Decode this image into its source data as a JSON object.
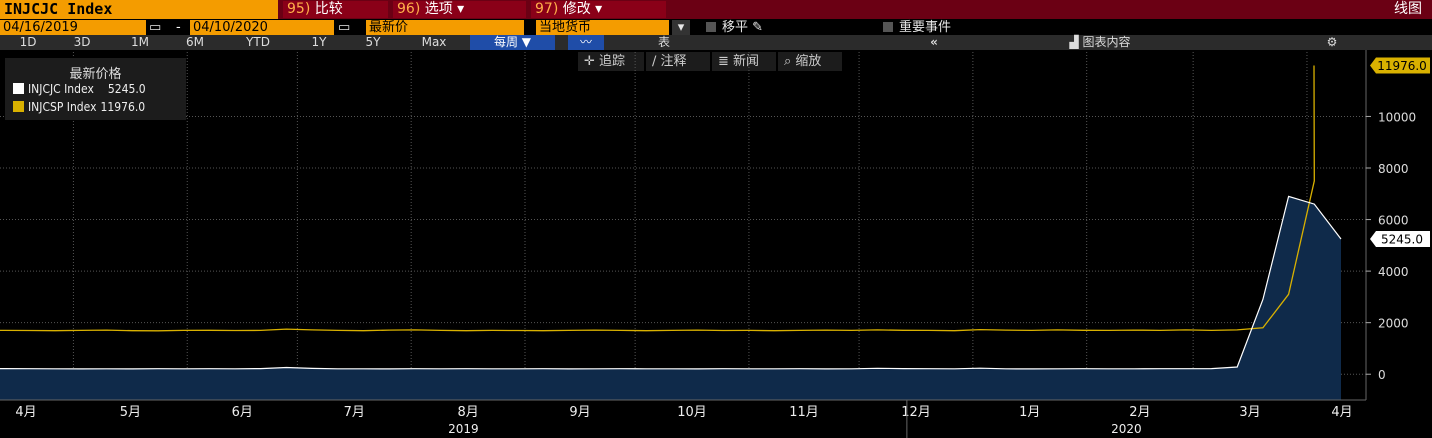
{
  "header": {
    "ticker": "INJCJC Index",
    "buttons": [
      {
        "num": "95)",
        "label": "比较"
      },
      {
        "num": "96)",
        "label": "选项 ▾"
      },
      {
        "num": "97)",
        "label": "修改 ▾"
      }
    ],
    "right_label": "线图"
  },
  "controls": {
    "start_date": "04/16/2019",
    "dash": "-",
    "end_date": "04/10/2020",
    "field": "最新价",
    "currency": "当地货币",
    "shift_label": "移平",
    "events_label": "重要事件"
  },
  "ranges": [
    "1D",
    "3D",
    "1M",
    "6M",
    "YTD",
    "1Y",
    "5Y",
    "Max"
  ],
  "frequency": "每周 ▼",
  "table_label": "表",
  "chart_content_label": "图表内容",
  "toolbar": [
    "追踪",
    "注释",
    "新闻",
    "缩放"
  ],
  "colors": {
    "series1": "#ffffff",
    "series2": "#d9b100",
    "area": "#0f2a4a"
  },
  "chart_data": {
    "type": "line",
    "title": "最新价格",
    "x_month_labels": [
      "4月",
      "5月",
      "6月",
      "7月",
      "8月",
      "9月",
      "10月",
      "11月",
      "12月",
      "1月",
      "2月",
      "3月",
      "4月"
    ],
    "years": [
      "2019",
      "2020"
    ],
    "ylim": [
      -1000,
      12500
    ],
    "yticks": [
      0,
      2000,
      4000,
      6000,
      8000,
      10000
    ],
    "series": [
      {
        "name": "INJCJC Index",
        "last": "5245.0",
        "color": "#ffffff",
        "x": [
          "2019-04-12",
          "2019-04-19",
          "2019-04-26",
          "2019-05-03",
          "2019-05-10",
          "2019-05-17",
          "2019-05-24",
          "2019-05-31",
          "2019-06-07",
          "2019-06-14",
          "2019-06-21",
          "2019-06-28",
          "2019-07-05",
          "2019-07-12",
          "2019-07-19",
          "2019-07-26",
          "2019-08-02",
          "2019-08-09",
          "2019-08-16",
          "2019-08-23",
          "2019-08-30",
          "2019-09-06",
          "2019-09-13",
          "2019-09-20",
          "2019-09-27",
          "2019-10-04",
          "2019-10-11",
          "2019-10-18",
          "2019-10-25",
          "2019-11-01",
          "2019-11-08",
          "2019-11-15",
          "2019-11-22",
          "2019-11-29",
          "2019-12-06",
          "2019-12-13",
          "2019-12-20",
          "2019-12-27",
          "2020-01-03",
          "2020-01-10",
          "2020-01-17",
          "2020-01-24",
          "2020-01-31",
          "2020-02-07",
          "2020-02-14",
          "2020-02-21",
          "2020-02-28",
          "2020-03-06",
          "2020-03-13",
          "2020-03-20",
          "2020-03-27",
          "2020-04-03"
        ],
        "values": [
          220,
          215,
          210,
          205,
          212,
          208,
          214,
          210,
          215,
          212,
          218,
          260,
          225,
          212,
          210,
          208,
          213,
          210,
          215,
          212,
          210,
          214,
          208,
          212,
          215,
          212,
          210,
          208,
          215,
          212,
          210,
          213,
          208,
          212,
          230,
          220,
          215,
          212,
          235,
          210,
          208,
          212,
          215,
          212,
          210,
          215,
          213,
          220,
          280,
          2900,
          6900,
          6600
        ]
      },
      {
        "name": "INJCSP Index",
        "last": "11976.0",
        "color": "#d9b100",
        "x": [
          "2019-04-12",
          "2019-04-19",
          "2019-04-26",
          "2019-05-03",
          "2019-05-10",
          "2019-05-17",
          "2019-05-24",
          "2019-05-31",
          "2019-06-07",
          "2019-06-14",
          "2019-06-21",
          "2019-06-28",
          "2019-07-05",
          "2019-07-12",
          "2019-07-19",
          "2019-07-26",
          "2019-08-02",
          "2019-08-09",
          "2019-08-16",
          "2019-08-23",
          "2019-08-30",
          "2019-09-06",
          "2019-09-13",
          "2019-09-20",
          "2019-09-27",
          "2019-10-04",
          "2019-10-11",
          "2019-10-18",
          "2019-10-25",
          "2019-11-01",
          "2019-11-08",
          "2019-11-15",
          "2019-11-22",
          "2019-11-29",
          "2019-12-06",
          "2019-12-13",
          "2019-12-20",
          "2019-12-27",
          "2020-01-03",
          "2020-01-10",
          "2020-01-17",
          "2020-01-24",
          "2020-01-31",
          "2020-02-07",
          "2020-02-14",
          "2020-02-21",
          "2020-02-28",
          "2020-03-06",
          "2020-03-13",
          "2020-03-20",
          "2020-03-27",
          "2020-04-03"
        ],
        "values": [
          1700,
          1695,
          1690,
          1700,
          1710,
          1690,
          1685,
          1700,
          1705,
          1695,
          1700,
          1750,
          1720,
          1700,
          1690,
          1710,
          1720,
          1700,
          1690,
          1700,
          1695,
          1690,
          1700,
          1710,
          1700,
          1690,
          1700,
          1710,
          1695,
          1700,
          1690,
          1700,
          1710,
          1700,
          1720,
          1705,
          1700,
          1690,
          1730,
          1710,
          1700,
          1720,
          1705,
          1700,
          1710,
          1700,
          1720,
          1700,
          1720,
          1800,
          3100,
          7500
        ]
      }
    ]
  }
}
